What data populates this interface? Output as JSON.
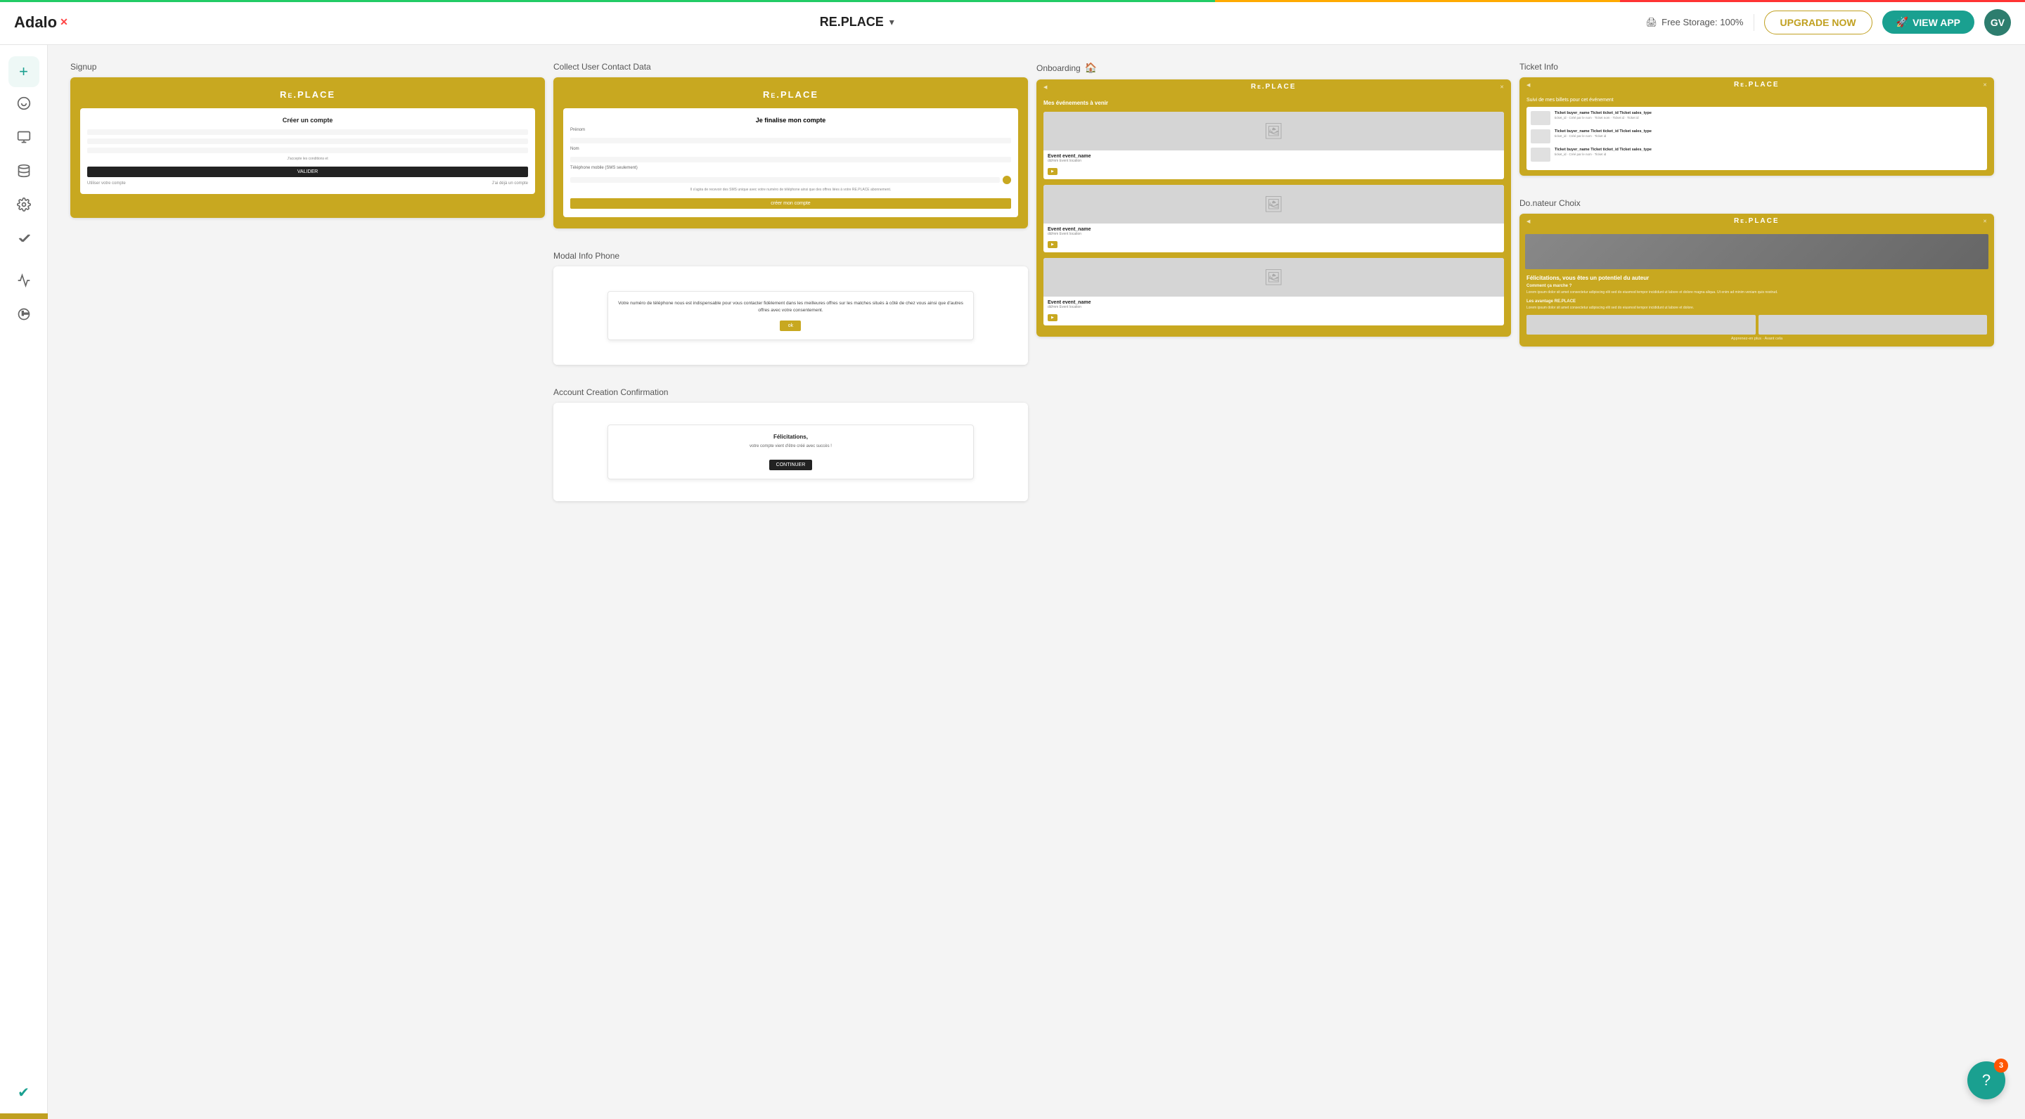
{
  "topbar": {
    "logo": "Adalo",
    "app_name": "RE.PLACE",
    "storage": "Free Storage: 100%",
    "upgrade_label": "UPGRADE NOW",
    "view_app_label": "VIEW APP",
    "avatar": "GV"
  },
  "sidebar": {
    "items": [
      {
        "id": "add",
        "icon": "+",
        "label": "Add component"
      },
      {
        "id": "palette",
        "icon": "🎨",
        "label": "Theme"
      },
      {
        "id": "screens",
        "icon": "⬜",
        "label": "Screens"
      },
      {
        "id": "database",
        "icon": "🗄️",
        "label": "Database"
      },
      {
        "id": "settings",
        "icon": "⚙️",
        "label": "Settings"
      },
      {
        "id": "publish",
        "icon": "✔",
        "label": "Publish"
      },
      {
        "id": "analytics",
        "icon": "📈",
        "label": "Analytics"
      },
      {
        "id": "history",
        "icon": "🕐",
        "label": "History"
      },
      {
        "id": "check",
        "icon": "✔",
        "label": "Check"
      }
    ]
  },
  "screens": [
    {
      "id": "signup",
      "label": "Signup",
      "home": false,
      "type": "signup"
    },
    {
      "id": "collect-contact",
      "label": "Collect User Contact Data",
      "home": false,
      "type": "collect-contact"
    },
    {
      "id": "modal-phone",
      "label": "Modal Info Phone",
      "home": false,
      "type": "modal-phone"
    },
    {
      "id": "account-confirm",
      "label": "Account Creation Confirmation",
      "home": false,
      "type": "account-confirm"
    },
    {
      "id": "onboarding",
      "label": "Onboarding",
      "home": true,
      "type": "onboarding"
    },
    {
      "id": "ticket-info",
      "label": "Ticket Info",
      "home": false,
      "type": "ticket-info"
    },
    {
      "id": "donateur-choix",
      "label": "Do.nateur Choix",
      "home": false,
      "type": "donateur-choix"
    }
  ],
  "support": {
    "badge": "3"
  }
}
